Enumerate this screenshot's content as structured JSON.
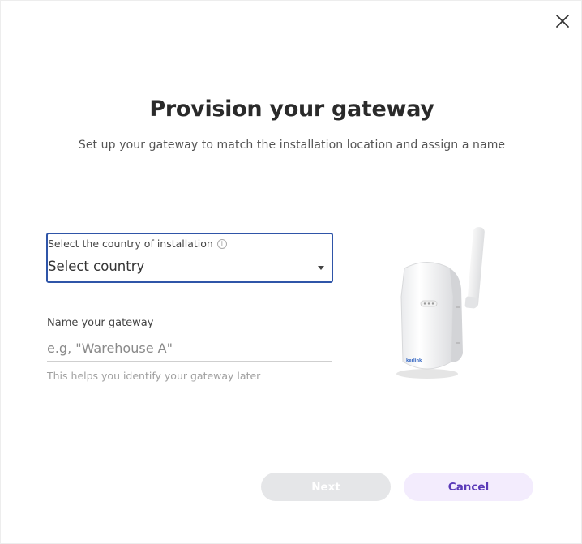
{
  "dialog": {
    "title": "Provision your gateway",
    "subtitle": "Set up your gateway to match the installation location and assign a name"
  },
  "country": {
    "label": "Select the country of installation",
    "info_icon": "info-icon",
    "selected_value": "Select country"
  },
  "gateway_name": {
    "label": "Name your gateway",
    "placeholder": "e.g, \"Warehouse A\"",
    "value": "",
    "helper": "This helps you identify your gateway later"
  },
  "device": {
    "image_icon": "gateway-device-image",
    "brand_mark": "kerlink"
  },
  "buttons": {
    "next_label": "Next",
    "cancel_label": "Cancel"
  },
  "colors": {
    "focus_border": "#2f55a8",
    "next_bg_disabled": "#e5e6e8",
    "cancel_bg": "#f3ecfd",
    "cancel_text": "#5a3ab8"
  },
  "icons": {
    "close": "close-icon",
    "dropdown": "chevron-down-icon"
  }
}
